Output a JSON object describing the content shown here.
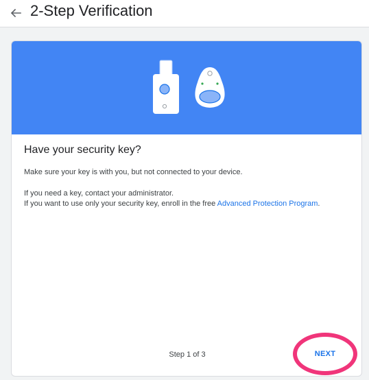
{
  "header": {
    "title": "2-Step Verification",
    "back_icon": "arrow-left-icon"
  },
  "colors": {
    "hero_background": "#4285f4",
    "link": "#1a73e8",
    "highlight_ring": "#f0357a"
  },
  "card": {
    "illustration_icons": [
      "usb-security-key-icon",
      "bluetooth-security-key-icon"
    ],
    "title": "Have your security key?",
    "paragraph1": "Make sure your key is with you, but not connected to your device.",
    "paragraph2": "If you need a key, contact your administrator.",
    "paragraph3_prefix": "If you want to use only your security key, enroll in the free ",
    "paragraph3_link": "Advanced Protection Program",
    "paragraph3_suffix": ".",
    "step_text": "Step 1 of 3",
    "next_label": "NEXT"
  }
}
